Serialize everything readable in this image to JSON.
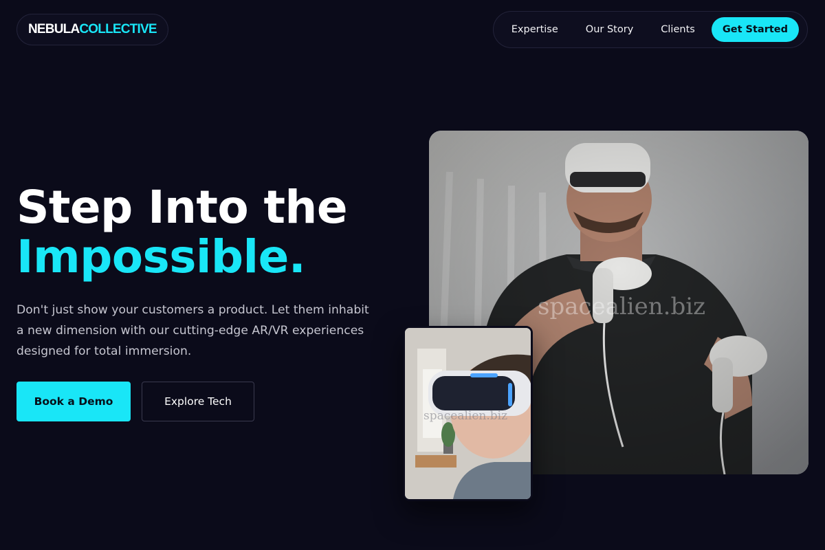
{
  "brand": {
    "part1": "NEBULA",
    "part2": "COLLECTIVE"
  },
  "nav": {
    "items": [
      {
        "label": "Expertise"
      },
      {
        "label": "Our Story"
      },
      {
        "label": "Clients"
      }
    ],
    "cta_label": "Get Started"
  },
  "hero": {
    "title_line1": "Step Into the",
    "title_line2": "Impossible.",
    "description": "Don't just show your customers a product. Let them inhabit a new dimension with our cutting-edge AR/VR experiences designed for total immersion.",
    "primary_button": "Book a Demo",
    "secondary_button": "Explore Tech"
  },
  "images": {
    "main_watermark": "spacealien.biz",
    "small_watermark": "spacealien.biz"
  },
  "colors": {
    "background": "#0b0b1a",
    "accent": "#19e6f7",
    "text": "#ffffff",
    "muted_text": "#c6c6d0"
  }
}
